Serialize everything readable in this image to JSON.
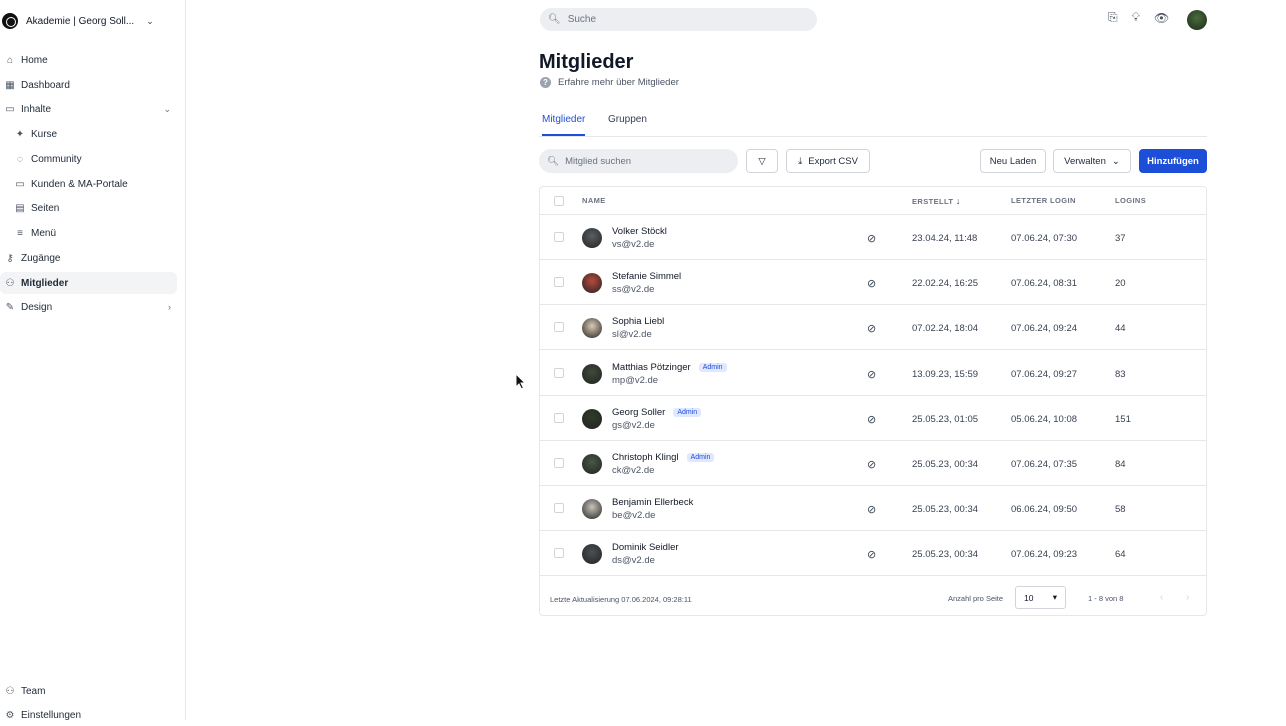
{
  "sidebar": {
    "brand": "Akademie | Georg Soll...",
    "items": [
      {
        "label": "Home",
        "icon": "home-icon",
        "glyph": "⌂"
      },
      {
        "label": "Dashboard",
        "icon": "dashboard-icon",
        "glyph": "▦"
      },
      {
        "label": "Inhalte",
        "icon": "folder-icon",
        "glyph": "▭",
        "right": "⌄"
      },
      {
        "label": "Kurse",
        "icon": "graduation-cap-icon",
        "glyph": "✦"
      },
      {
        "label": "Community",
        "icon": "chat-icon",
        "glyph": "◌"
      },
      {
        "label": "Kunden & MA-Portale",
        "icon": "monitor-icon",
        "glyph": "▭"
      },
      {
        "label": "Seiten",
        "icon": "pages-icon",
        "glyph": "▤"
      },
      {
        "label": "Menü",
        "icon": "menu-icon",
        "glyph": "≡"
      },
      {
        "label": "Zugänge",
        "icon": "key-icon",
        "glyph": "⚷"
      },
      {
        "label": "Mitglieder",
        "icon": "members-icon",
        "glyph": "⚇"
      },
      {
        "label": "Design",
        "icon": "brush-icon",
        "glyph": "✎",
        "right": "›"
      }
    ],
    "bottom": [
      {
        "label": "Team",
        "icon": "team-icon",
        "glyph": "⚇"
      },
      {
        "label": "Einstellungen",
        "icon": "gear-icon",
        "glyph": "⚙"
      }
    ]
  },
  "topbar": {
    "search_placeholder": "Suche"
  },
  "page": {
    "title": "Mitglieder",
    "subtitle": "Erfahre mehr über Mitglieder",
    "tabs": [
      "Mitglieder",
      "Gruppen"
    ]
  },
  "toolbar": {
    "search_placeholder": "Mitglied suchen",
    "export": "Export CSV",
    "reload": "Neu Laden",
    "manage": "Verwalten",
    "add": "Hinzufügen"
  },
  "table": {
    "headers": {
      "name": "NAME",
      "created": "ERSTELLT",
      "last_login": "LETZTER LOGIN",
      "logins": "LOGINS"
    },
    "rows": [
      {
        "name": "Volker Stöckl",
        "email": "vs@v2.de",
        "badge": "",
        "created": "23.04.24, 11:48",
        "last_login": "07.06.24, 07:30",
        "logins": "37"
      },
      {
        "name": "Stefanie Simmel",
        "email": "ss@v2.de",
        "badge": "",
        "created": "22.02.24, 16:25",
        "last_login": "07.06.24, 08:31",
        "logins": "20"
      },
      {
        "name": "Sophia Liebl",
        "email": "sl@v2.de",
        "badge": "",
        "created": "07.02.24, 18:04",
        "last_login": "07.06.24, 09:24",
        "logins": "44"
      },
      {
        "name": "Matthias Pötzinger",
        "email": "mp@v2.de",
        "badge": "Admin",
        "created": "13.09.23, 15:59",
        "last_login": "07.06.24, 09:27",
        "logins": "83"
      },
      {
        "name": "Georg Soller",
        "email": "gs@v2.de",
        "badge": "Admin",
        "created": "25.05.23, 01:05",
        "last_login": "05.06.24, 10:08",
        "logins": "151"
      },
      {
        "name": "Christoph Klingl",
        "email": "ck@v2.de",
        "badge": "Admin",
        "created": "25.05.23, 00:34",
        "last_login": "07.06.24, 07:35",
        "logins": "84"
      },
      {
        "name": "Benjamin Ellerbeck",
        "email": "be@v2.de",
        "badge": "",
        "created": "25.05.23, 00:34",
        "last_login": "06.06.24, 09:50",
        "logins": "58"
      },
      {
        "name": "Dominik Seidler",
        "email": "ds@v2.de",
        "badge": "",
        "created": "25.05.23, 00:34",
        "last_login": "07.06.24, 09:23",
        "logins": "64"
      }
    ],
    "footer": {
      "updated": "Letzte Aktualisierung 07.06.2024, 09:28:11",
      "per_page_label": "Anzahl pro Seite",
      "per_page_value": "10",
      "range": "1 - 8 von 8"
    }
  },
  "colors": {
    "accent": "#1d4ed8",
    "badge_bg": "#e0e7ff"
  }
}
